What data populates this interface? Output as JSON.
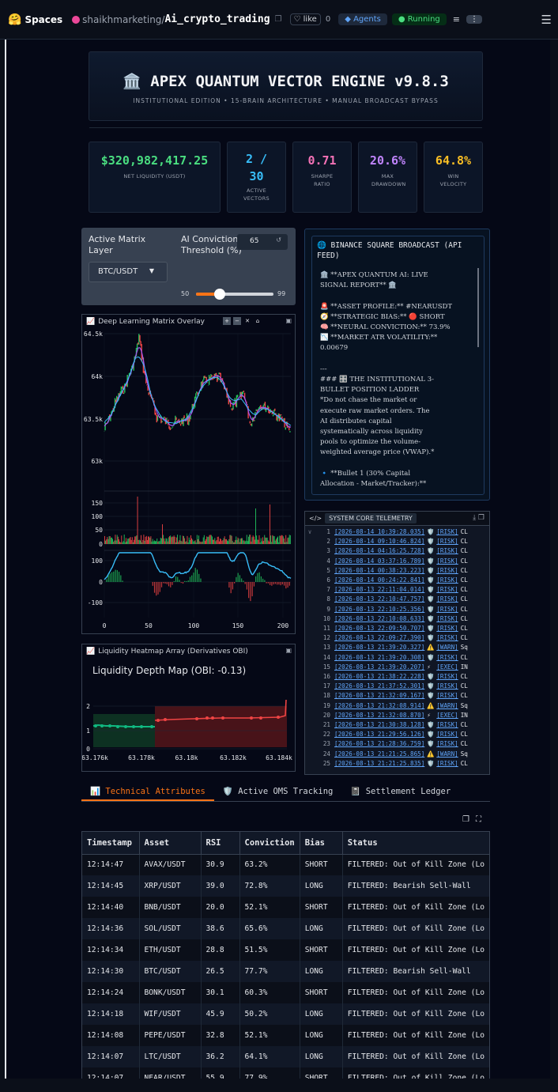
{
  "topbar": {
    "brand": "Spaces",
    "owner": "shaikhmarketing/",
    "repo": "Ai_crypto_trading",
    "like_label": "like",
    "like_count": "0",
    "agents_label": "Agents",
    "status_label": "Running"
  },
  "hero": {
    "title": "🏛️ APEX QUANTUM VECTOR ENGINE v9.8.3",
    "subtitle": "INSTITUTIONAL EDITION • 15-BRAIN ARCHITECTURE • MANUAL BROADCAST BYPASS"
  },
  "metrics": [
    {
      "value": "$320,982,417.25",
      "label": "NET LIQUIDITY (USDT)",
      "color": "#4ade80"
    },
    {
      "value": "2 / 30",
      "label": "ACTIVE VECTORS",
      "color": "#38bdf8"
    },
    {
      "value": "0.71",
      "label": "SHARPE RATIO",
      "color": "#f472b6"
    },
    {
      "value": "20.6%",
      "label": "MAX DRAWDOWN",
      "color": "#c084fc"
    },
    {
      "value": "64.8%",
      "label": "WIN VELOCITY",
      "color": "#fbbf24"
    }
  ],
  "controls": {
    "matrix_label": "Active Matrix Layer",
    "matrix_value": "BTC/USDT",
    "threshold_label": "AI Conviction Threshold (%)",
    "threshold_value": "65",
    "threshold_min": "50",
    "threshold_max": "99",
    "threshold_fraction": 0.31
  },
  "matrix_chart": {
    "title": "Deep Learning Matrix Overlay",
    "price_ticks": [
      "64.5k",
      "64k",
      "63.5k",
      "63k"
    ],
    "volume_ticks": [
      "150",
      "100",
      "50",
      "0"
    ],
    "osc_ticks": [
      "100",
      "0",
      "-100"
    ],
    "x_ticks": [
      "0",
      "50",
      "100",
      "150",
      "200"
    ]
  },
  "heatmap": {
    "title": "Liquidity Heatmap Array (Derivatives OBI)",
    "chart_title": "Liquidity Depth Map (OBI: -0.13)",
    "y_ticks": [
      "2",
      "1",
      "0"
    ],
    "x_ticks": [
      "63.176k",
      "63.178k",
      "63.18k",
      "63.182k",
      "63.184k"
    ]
  },
  "broadcast": {
    "title": "🌐 BINANCE SQUARE BROADCAST (API FEED)",
    "body": "🏛️ **APEX QUANTUM AI: LIVE\nSIGNAL REPORT** 🏛️\n\n🚨 **ASSET PROFILE:** #NEARUSDT\n🧭 **STRATEGIC BIAS:** 🔴 SHORT\n🧠 **NEURAL CONVICTION:** 73.9%\n📉 **MARKET ATR VOLATILITY:**\n0.00679\n\n---\n### 🎛️ THE INSTITUTIONAL 3-\nBULLET POSITION LADDER\n*Do not chase the market or\nexecute raw market orders. The\nAI distributes capital\nsystematically across liquidity\npools to optimize the volume-\nweighted average price (VWAP).*\n\n🔹 **Bullet 1 (30% Capital\nAllocation - Market/Tracker):**"
  },
  "telemetry": {
    "title": "SYSTEM CORE TELEMETRY",
    "rows": [
      {
        "n": "1",
        "ts": "[2026-08-14 10:39:28.035]",
        "icon": "🛡️",
        "lv": "[RISK]",
        "msg": "CL",
        "lc": "#60a5fa"
      },
      {
        "n": "2",
        "ts": "[2026-08-14 09:10:46.824]",
        "icon": "🛡️",
        "lv": "[RISK]",
        "msg": "CL",
        "lc": "#60a5fa"
      },
      {
        "n": "3",
        "ts": "[2026-08-14 04:16:25.728]",
        "icon": "🛡️",
        "lv": "[RISK]",
        "msg": "CL",
        "lc": "#60a5fa"
      },
      {
        "n": "4",
        "ts": "[2026-08-14 03:37:16.789]",
        "icon": "🛡️",
        "lv": "[RISK]",
        "msg": "CL",
        "lc": "#60a5fa"
      },
      {
        "n": "5",
        "ts": "[2026-08-14 00:38:23.223]",
        "icon": "🛡️",
        "lv": "[RISK]",
        "msg": "CL",
        "lc": "#60a5fa"
      },
      {
        "n": "6",
        "ts": "[2026-08-14 00:24:22.841]",
        "icon": "🛡️",
        "lv": "[RISK]",
        "msg": "CL",
        "lc": "#60a5fa"
      },
      {
        "n": "7",
        "ts": "[2026-08-13 22:11:04.014]",
        "icon": "🛡️",
        "lv": "[RISK]",
        "msg": "CL",
        "lc": "#60a5fa"
      },
      {
        "n": "8",
        "ts": "[2026-08-13 22:10:47.757]",
        "icon": "🛡️",
        "lv": "[RISK]",
        "msg": "CL",
        "lc": "#60a5fa"
      },
      {
        "n": "9",
        "ts": "[2026-08-13 22:10:25.356]",
        "icon": "🛡️",
        "lv": "[RISK]",
        "msg": "CL",
        "lc": "#60a5fa"
      },
      {
        "n": "10",
        "ts": "[2026-08-13 22:10:08.633]",
        "icon": "🛡️",
        "lv": "[RISK]",
        "msg": "CL",
        "lc": "#60a5fa"
      },
      {
        "n": "11",
        "ts": "[2026-08-13 22:09:50.707]",
        "icon": "🛡️",
        "lv": "[RISK]",
        "msg": "CL",
        "lc": "#60a5fa"
      },
      {
        "n": "12",
        "ts": "[2026-08-13 22:09:27.390]",
        "icon": "🛡️",
        "lv": "[RISK]",
        "msg": "CL",
        "lc": "#60a5fa"
      },
      {
        "n": "13",
        "ts": "[2026-08-13 21:39:20.327]",
        "icon": "⚠️",
        "lv": "[WARN]",
        "msg": "Sq",
        "lc": "#60a5fa"
      },
      {
        "n": "14",
        "ts": "[2026-08-13 21:39:20.308]",
        "icon": "🛡️",
        "lv": "[RISK]",
        "msg": "CL",
        "lc": "#60a5fa"
      },
      {
        "n": "15",
        "ts": "[2026-08-13 21:39:20.207]",
        "icon": "⚡",
        "lv": "[EXEC]",
        "msg": "IN",
        "lc": "#60a5fa"
      },
      {
        "n": "16",
        "ts": "[2026-08-13 21:38:22.228]",
        "icon": "🛡️",
        "lv": "[RISK]",
        "msg": "CL",
        "lc": "#60a5fa"
      },
      {
        "n": "17",
        "ts": "[2026-08-13 21:37:52.301]",
        "icon": "🛡️",
        "lv": "[RISK]",
        "msg": "CL",
        "lc": "#60a5fa"
      },
      {
        "n": "18",
        "ts": "[2026-08-13 21:32:09.167]",
        "icon": "🛡️",
        "lv": "[RISK]",
        "msg": "CL",
        "lc": "#60a5fa"
      },
      {
        "n": "19",
        "ts": "[2026-08-13 21:32:08.914]",
        "icon": "⚠️",
        "lv": "[WARN]",
        "msg": "Sq",
        "lc": "#60a5fa"
      },
      {
        "n": "20",
        "ts": "[2026-08-13 21:32:08.870]",
        "icon": "⚡",
        "lv": "[EXEC]",
        "msg": "IN",
        "lc": "#60a5fa"
      },
      {
        "n": "21",
        "ts": "[2026-08-13 21:30:38.128]",
        "icon": "🛡️",
        "lv": "[RISK]",
        "msg": "CL",
        "lc": "#60a5fa"
      },
      {
        "n": "22",
        "ts": "[2026-08-13 21:29:56.126]",
        "icon": "🛡️",
        "lv": "[RISK]",
        "msg": "CL",
        "lc": "#60a5fa"
      },
      {
        "n": "23",
        "ts": "[2026-08-13 21:28:36.759]",
        "icon": "🛡️",
        "lv": "[RISK]",
        "msg": "CL",
        "lc": "#60a5fa"
      },
      {
        "n": "24",
        "ts": "[2026-08-13 21:21:25.865]",
        "icon": "⚠️",
        "lv": "[WARN]",
        "msg": "Sq",
        "lc": "#60a5fa"
      },
      {
        "n": "25",
        "ts": "[2026-08-13 21:21:25.835]",
        "icon": "🛡️",
        "lv": "[RISK]",
        "msg": "CL",
        "lc": "#60a5fa"
      }
    ]
  },
  "tabs": [
    {
      "label": "📊 Technical Attributes",
      "active": true
    },
    {
      "label": "🛡️ Active OMS Tracking",
      "active": false
    },
    {
      "label": "📓 Settlement Ledger",
      "active": false
    }
  ],
  "table": {
    "headers": [
      "Timestamp",
      "Asset",
      "RSI",
      "Conviction",
      "Bias",
      "Status"
    ],
    "rows": [
      [
        "12:14:47",
        "AVAX/USDT",
        "30.9",
        "63.2%",
        "SHORT",
        "FILTERED: Out of Kill Zone (Lo"
      ],
      [
        "12:14:45",
        "XRP/USDT",
        "39.0",
        "72.8%",
        "LONG",
        "FILTERED: Bearish Sell-Wall"
      ],
      [
        "12:14:40",
        "BNB/USDT",
        "20.0",
        "52.1%",
        "SHORT",
        "FILTERED: Out of Kill Zone (Lo"
      ],
      [
        "12:14:36",
        "SOL/USDT",
        "38.6",
        "65.6%",
        "LONG",
        "FILTERED: Out of Kill Zone (Lo"
      ],
      [
        "12:14:34",
        "ETH/USDT",
        "28.8",
        "51.5%",
        "SHORT",
        "FILTERED: Out of Kill Zone (Lo"
      ],
      [
        "12:14:30",
        "BTC/USDT",
        "26.5",
        "77.7%",
        "LONG",
        "FILTERED: Bearish Sell-Wall"
      ],
      [
        "12:14:24",
        "BONK/USDT",
        "30.1",
        "60.3%",
        "SHORT",
        "FILTERED: Out of Kill Zone (Lo"
      ],
      [
        "12:14:18",
        "WIF/USDT",
        "45.9",
        "50.2%",
        "LONG",
        "FILTERED: Out of Kill Zone (Lo"
      ],
      [
        "12:14:08",
        "PEPE/USDT",
        "32.8",
        "52.1%",
        "LONG",
        "FILTERED: Out of Kill Zone (Lo"
      ],
      [
        "12:14:07",
        "LTC/USDT",
        "36.2",
        "64.1%",
        "LONG",
        "FILTERED: Out of Kill Zone (Lo"
      ],
      [
        "12:14:07",
        "NEAR/USDT",
        "55.9",
        "77.9%",
        "SHORT",
        "FILTERED: Out of Kill Zone (Lo"
      ]
    ]
  }
}
